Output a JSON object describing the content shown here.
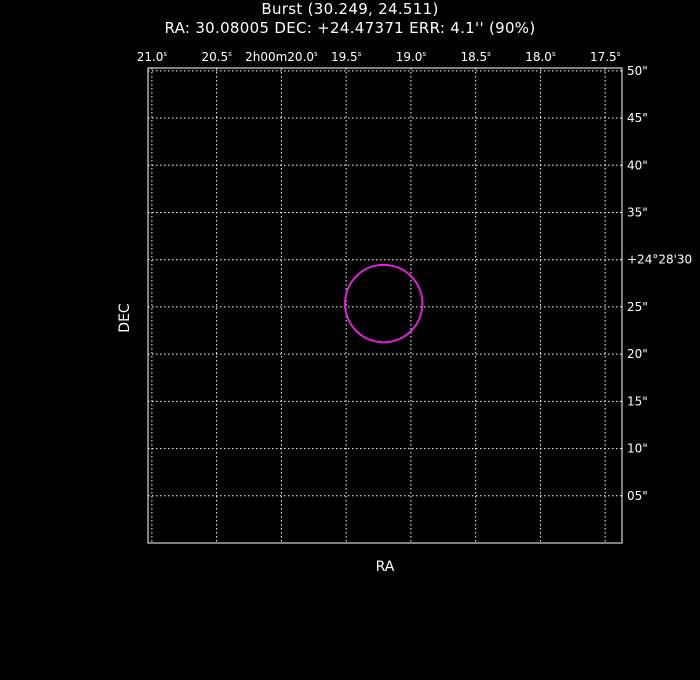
{
  "chart_data": {
    "type": "scatter",
    "title": "Burst (30.249, 24.511)",
    "subtitle": "RA: 30.08005   DEC: +24.47371   ERR: 4.1'' (90%)",
    "xlabel": "RA",
    "ylabel": "DEC",
    "x_ticks": [
      {
        "label": "21.0",
        "sec": 21.0
      },
      {
        "label": "20.5",
        "sec": 20.5
      },
      {
        "label": "2h00m20.0",
        "sec": 20.0
      },
      {
        "label": "19.5",
        "sec": 19.5
      },
      {
        "label": "19.0",
        "sec": 19.0
      },
      {
        "label": "18.5",
        "sec": 18.5
      },
      {
        "label": "18.0",
        "sec": 18.0
      },
      {
        "label": "17.5",
        "sec": 17.5
      }
    ],
    "y_ticks": [
      {
        "label": "50\"",
        "arcsec": 50
      },
      {
        "label": "45\"",
        "arcsec": 45
      },
      {
        "label": "40\"",
        "arcsec": 40
      },
      {
        "label": "35\"",
        "arcsec": 35
      },
      {
        "label": "+24°28'30",
        "arcsec": 30
      },
      {
        "label": "25\"",
        "arcsec": 25
      },
      {
        "label": "20\"",
        "arcsec": 20
      },
      {
        "label": "15\"",
        "arcsec": 15
      },
      {
        "label": "10\"",
        "arcsec": 10
      },
      {
        "label": "05\"",
        "arcsec": 5
      }
    ],
    "xlim_sec": [
      21.03,
      17.37
    ],
    "ylim_arcsec": [
      0,
      50.3
    ],
    "grid": true,
    "error_circle": {
      "ra_sec": 19.21,
      "dec_arcsec": 25.35,
      "radius_arcsec": 4.1,
      "color": "#e020e0"
    }
  }
}
